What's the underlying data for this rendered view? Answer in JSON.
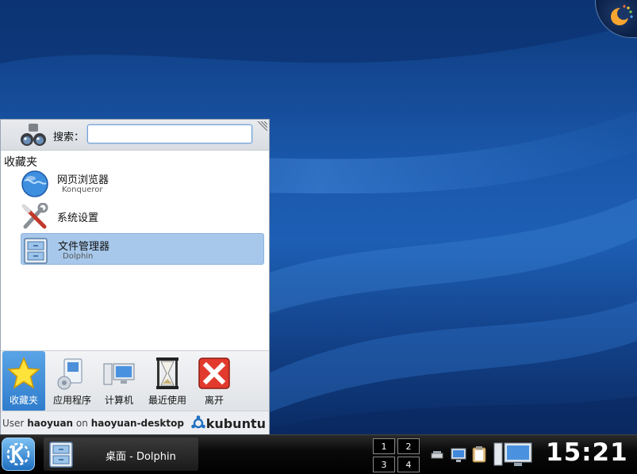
{
  "kickoff": {
    "search_label": "搜索：",
    "search_value": "",
    "section_title": "收藏夹",
    "favorites": [
      {
        "title": "网页浏览器",
        "subtitle": "Konqueror",
        "icon": "globe-icon"
      },
      {
        "title": "系统设置",
        "subtitle": "",
        "icon": "tools-icon"
      },
      {
        "title": "文件管理器",
        "subtitle": "Dolphin",
        "icon": "file-cabinet-icon",
        "selected": true
      }
    ],
    "tabs": [
      {
        "label": "收藏夹",
        "icon": "star-icon",
        "active": true
      },
      {
        "label": "应用程序",
        "icon": "applications-icon",
        "active": false
      },
      {
        "label": "计算机",
        "icon": "computer-icon",
        "active": false
      },
      {
        "label": "最近使用",
        "icon": "hourglass-icon",
        "active": false
      },
      {
        "label": "离开",
        "icon": "exit-icon",
        "active": false
      }
    ],
    "footer": {
      "user_prefix": "User",
      "username": "haoyuan",
      "on": "on",
      "hostname": "haoyuan-desktop",
      "brand": "kubuntu"
    }
  },
  "taskbar": {
    "task_label": "桌面 - Dolphin",
    "pager": [
      "1",
      "2",
      "3",
      "4"
    ],
    "clock": "15:21"
  },
  "colors": {
    "accent": "#2e7ccc",
    "selection": "#a7c8ea",
    "panel": "#000000"
  }
}
